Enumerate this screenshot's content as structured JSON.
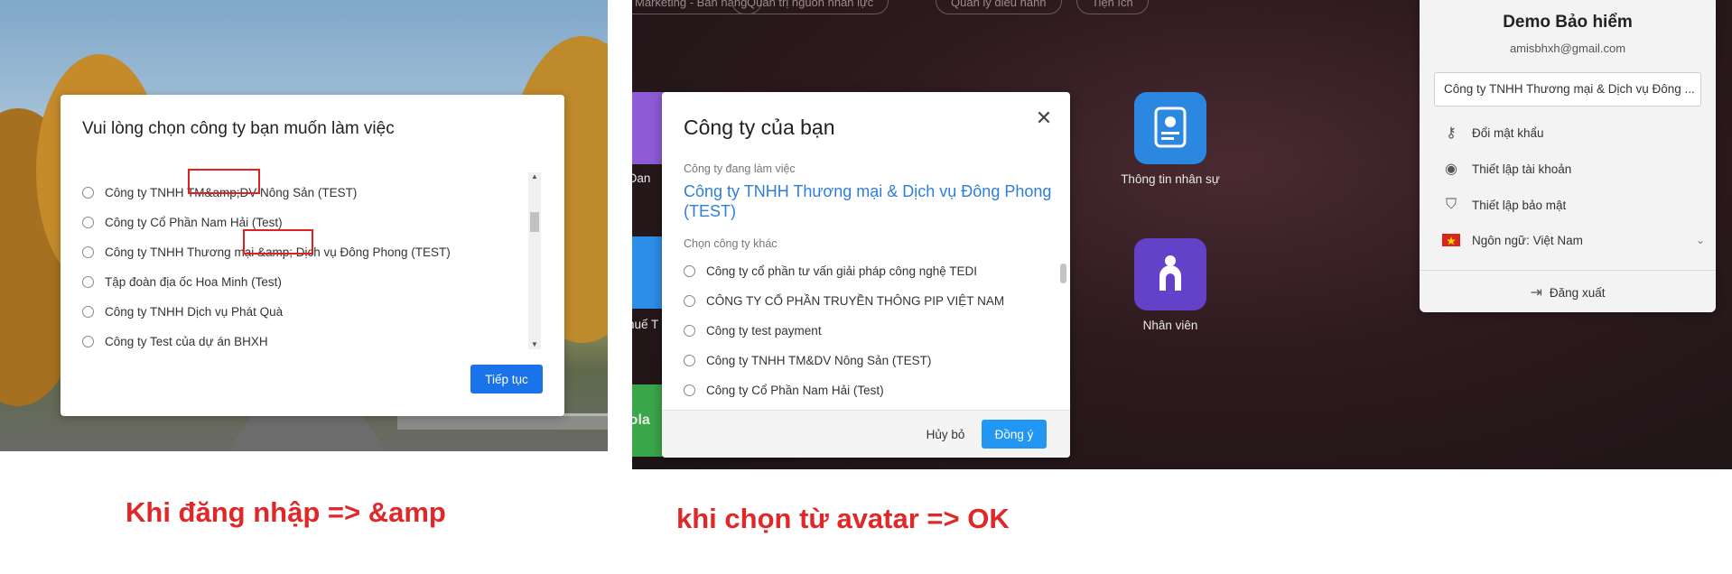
{
  "left": {
    "dialog_title": "Vui lòng chọn công ty bạn muốn làm việc",
    "companies": [
      "Công ty TNHH TM&amp;DV Nông Sản (TEST)",
      "Công ty Cổ Phần Nam Hải (Test)",
      "Công ty TNHH Thương mại &amp; Dịch vụ Đông Phong (TEST)",
      "Tập đoàn địa ốc Hoa Minh (Test)",
      "Công ty TNHH Dịch vụ Phát Quà",
      "Công ty Test của dự án BHXH"
    ],
    "continue_label": "Tiếp tục"
  },
  "right": {
    "top_pills": [
      "Marketing - Bán hàng",
      "Quản trị nguồn nhân lực",
      "Quản lý điều hành",
      "Tiện ích"
    ],
    "apps": [
      {
        "label": "Dan"
      },
      {
        "label": "Thuế T"
      },
      {
        "label": "Gola"
      },
      {
        "label": "Thông tin nhân sự"
      },
      {
        "label": "Nhân viên"
      }
    ],
    "dialog": {
      "title": "Công ty của bạn",
      "current_label": "Công ty đang làm việc",
      "current_company": "Công ty TNHH Thương mại & Dịch vụ Đông Phong (TEST)",
      "other_label": "Chọn công ty khác",
      "others": [
        "Công ty cổ phần tư vấn giải pháp công nghệ TEDI",
        "CÔNG TY CỔ PHẦN TRUYỀN THÔNG PIP VIỆT NAM",
        "Công ty test payment",
        "Công ty TNHH TM&DV Nông Sản (TEST)",
        "Công ty Cổ Phần Nam Hải (Test)"
      ],
      "cancel_label": "Hủy bỏ",
      "agree_label": "Đồng ý"
    },
    "account": {
      "name": "Demo Bảo hiểm",
      "email": "amisbhxh@gmail.com",
      "company": "Công ty TNHH Thương mại & Dịch vụ Đông ...",
      "menu": [
        "Đổi mật khẩu",
        "Thiết lập tài khoản",
        "Thiết lập bảo mật",
        "Ngôn ngữ: Việt Nam"
      ],
      "logout": "Đăng xuất"
    }
  },
  "captions": {
    "left": "Khi đăng nhập => &amp",
    "right": "khi chọn từ avatar => OK"
  },
  "colors": {
    "highlight": "#e0201c",
    "primary": "#1a73e8",
    "link": "#2f7ed8",
    "caption": "#e12828"
  }
}
